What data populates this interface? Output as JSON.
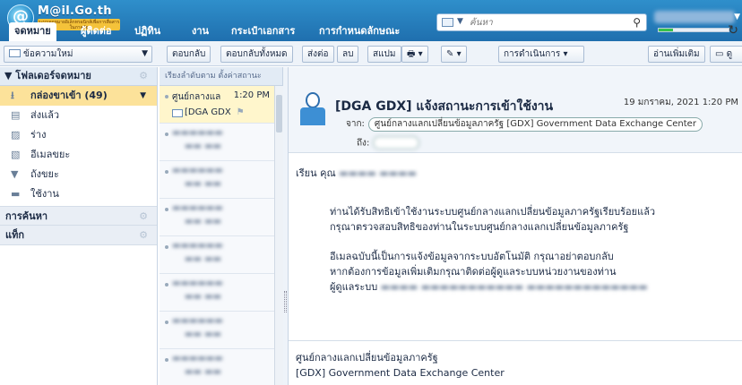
{
  "app": {
    "logo_text": "M@il.Go.th",
    "logo_sub": "ระบบจดหมายอิเล็กทรอนิกส์เพื่อการสื่อสารในภาครัฐ"
  },
  "search": {
    "placeholder": "ค้นหา"
  },
  "tabs": [
    {
      "label": "จดหมาย"
    },
    {
      "label": "ผู้ติดต่อ"
    },
    {
      "label": "ปฏิทิน"
    },
    {
      "label": "งาน"
    },
    {
      "label": "กระเป๋าเอกสาร"
    },
    {
      "label": "การกำหนดลักษณะ"
    }
  ],
  "toolbar": {
    "new_message": "ข้อความใหม่",
    "reply": "ตอบกลับ",
    "reply_all": "ตอบกลับทั้งหมด",
    "forward": "ส่งต่อ",
    "delete": "ลบ",
    "spam": "สแปม",
    "actions": "การดำเนินการ",
    "read_more": "อ่านเพิ่มเติม",
    "view": "ดู"
  },
  "sidebar": {
    "folders_header": "โฟลเดอร์จดหมาย",
    "folders": [
      {
        "label": "กล่องขาเข้า (49)"
      },
      {
        "label": "ส่งแล้ว"
      },
      {
        "label": "ร่าง"
      },
      {
        "label": "อีเมลขยะ"
      },
      {
        "label": "ถังขยะ"
      },
      {
        "label": "ใช้งาน"
      }
    ],
    "search_header": "การค้นหา",
    "tags_header": "แท็ก"
  },
  "list": {
    "sort_header": "เรียงลำดับตาม ตั้งค่าสถานะ",
    "selected": {
      "sender": "ศูนย์กลางแล",
      "time": "1:20 PM",
      "subject": "[DGA GDX"
    }
  },
  "message": {
    "subject": "[DGA GDX] แจ้งสถานะการเข้าใช้งาน",
    "date": "19 มกราคม, 2021 1:20 PM",
    "from_label": "จาก:",
    "from": "ศูนย์กลางแลกเปลี่ยนข้อมูลภาครัฐ [GDX] Government Data Exchange Center",
    "to_label": "ถึง:",
    "greeting": "เรียน คุณ",
    "para1": [
      "ท่านได้รับสิทธิเข้าใช้งานระบบศูนย์กลางแลกเปลี่ยนข้อมูลภาครัฐเรียบร้อยแล้ว",
      "กรุณาตรวจสอบสิทธิของท่านในระบบศูนย์กลางแลกเปลี่ยนข้อมูลภาครัฐ"
    ],
    "para2": [
      "อีเมลฉบับนี้เป็นการแจ้งข้อมูลจากระบบอัตโนมัติ กรุณาอย่าตอบกลับ",
      "หากต้องการข้อมูลเพิ่มเติมกรุณาติดต่อผู้ดูแลระบบหน่วยงานของท่าน",
      "ผู้ดูแลระบบ"
    ],
    "signature": [
      "ศูนย์กลางแลกเปลี่ยนข้อมูลภาครัฐ",
      "[GDX] Government Data Exchange Center"
    ]
  }
}
